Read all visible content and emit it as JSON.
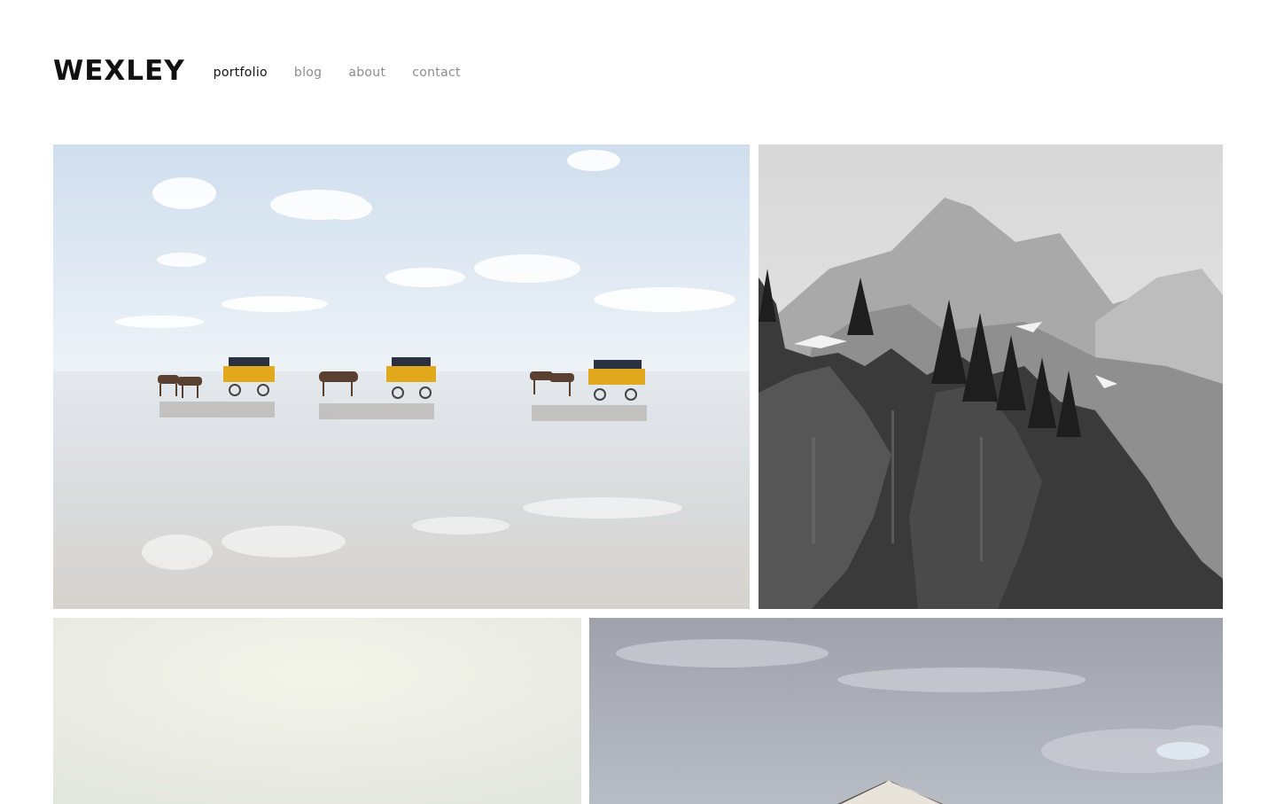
{
  "site": {
    "logo": "WEXLEY"
  },
  "nav": {
    "items": [
      {
        "label": "portfolio",
        "active": true
      },
      {
        "label": "blog",
        "active": false
      },
      {
        "label": "about",
        "active": false
      },
      {
        "label": "contact",
        "active": false
      }
    ]
  },
  "gallery": {
    "photos": [
      {
        "subject": "horse-drawn yellow wagons crossing shallow water on a beach"
      },
      {
        "subject": "black and white mountain cliff with pine trees"
      },
      {
        "subject": "foggy pale landscape"
      },
      {
        "subject": "barn roof under an overcast sky"
      }
    ]
  },
  "colors": {
    "text_active": "#111111",
    "text_muted": "#8c8c8c",
    "background": "#ffffff",
    "wagon_yellow": "#e2a91f"
  }
}
